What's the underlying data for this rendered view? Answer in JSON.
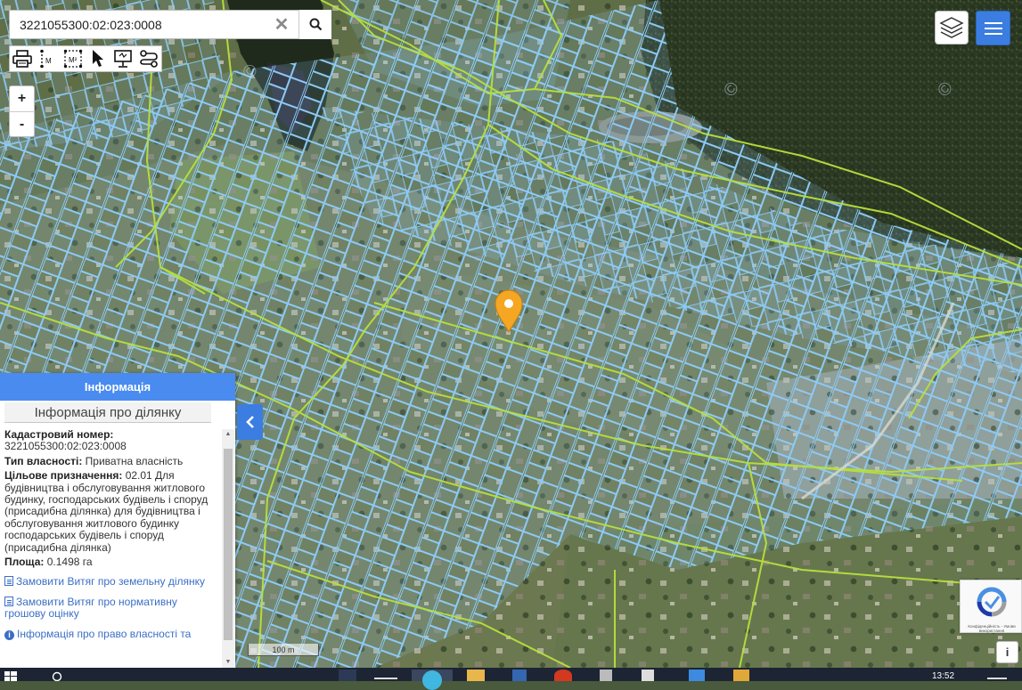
{
  "search": {
    "value": "3221055300:02:023:0008",
    "placeholder": ""
  },
  "toolbar": {
    "tools": [
      "print-icon",
      "measure-line-icon",
      "measure-area-icon",
      "pointer-icon",
      "presentation-icon",
      "route-icon"
    ],
    "measure_line_label": "M",
    "measure_area_label": "M²"
  },
  "zoom": {
    "in_label": "+",
    "out_label": "-"
  },
  "info_panel": {
    "header": "Інформація",
    "subtitle": "Інформація про ділянку",
    "cadastral_label": "Кадастровий номер:",
    "cadastral_value": "3221055300:02:023:0008",
    "ownership_label": "Тип власності:",
    "ownership_value": "Приватна власність",
    "purpose_label": "Цільове призначення:",
    "purpose_value": "02.01 Для будівництва і обслуговування житлового будинку, господарських будівель і споруд (присадибна ділянка) для будівництва і обслуговування житлового будинку господарських будівель і споруд (присадибна ділянка)",
    "area_label": "Площа:",
    "area_value": "0.1498 га",
    "links": [
      "Замовити Витяг про земельну ділянку",
      "Замовити Витяг про нормативну грошову оцінку",
      "Інформація про право власності та"
    ]
  },
  "map": {
    "scale_label": "100 m",
    "marker_color": "#f5a623",
    "parcel_color": "#8ccaf5",
    "road_color": "#b8e03c"
  },
  "captcha": {
    "text": "Конфіденційність - Умови використання"
  },
  "info_button_label": "i",
  "taskbar": {
    "clock": "13:52"
  },
  "colors": {
    "accent": "#4a8bf0",
    "menu": "#3b7de0"
  }
}
